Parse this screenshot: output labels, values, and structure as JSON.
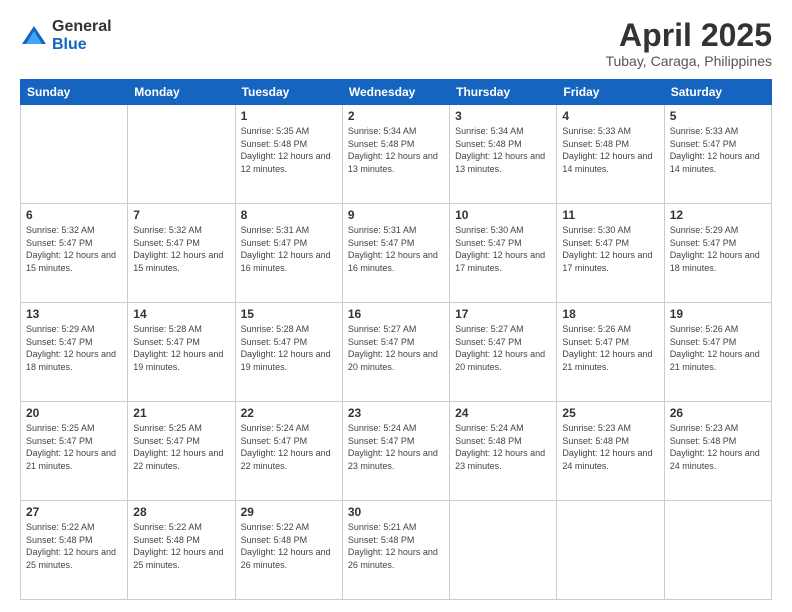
{
  "logo": {
    "general": "General",
    "blue": "Blue"
  },
  "title": "April 2025",
  "subtitle": "Tubay, Caraga, Philippines",
  "weekdays": [
    "Sunday",
    "Monday",
    "Tuesday",
    "Wednesday",
    "Thursday",
    "Friday",
    "Saturday"
  ],
  "weeks": [
    [
      {
        "day": "",
        "sunrise": "",
        "sunset": "",
        "daylight": ""
      },
      {
        "day": "",
        "sunrise": "",
        "sunset": "",
        "daylight": ""
      },
      {
        "day": "1",
        "sunrise": "Sunrise: 5:35 AM",
        "sunset": "Sunset: 5:48 PM",
        "daylight": "Daylight: 12 hours and 12 minutes."
      },
      {
        "day": "2",
        "sunrise": "Sunrise: 5:34 AM",
        "sunset": "Sunset: 5:48 PM",
        "daylight": "Daylight: 12 hours and 13 minutes."
      },
      {
        "day": "3",
        "sunrise": "Sunrise: 5:34 AM",
        "sunset": "Sunset: 5:48 PM",
        "daylight": "Daylight: 12 hours and 13 minutes."
      },
      {
        "day": "4",
        "sunrise": "Sunrise: 5:33 AM",
        "sunset": "Sunset: 5:48 PM",
        "daylight": "Daylight: 12 hours and 14 minutes."
      },
      {
        "day": "5",
        "sunrise": "Sunrise: 5:33 AM",
        "sunset": "Sunset: 5:47 PM",
        "daylight": "Daylight: 12 hours and 14 minutes."
      }
    ],
    [
      {
        "day": "6",
        "sunrise": "Sunrise: 5:32 AM",
        "sunset": "Sunset: 5:47 PM",
        "daylight": "Daylight: 12 hours and 15 minutes."
      },
      {
        "day": "7",
        "sunrise": "Sunrise: 5:32 AM",
        "sunset": "Sunset: 5:47 PM",
        "daylight": "Daylight: 12 hours and 15 minutes."
      },
      {
        "day": "8",
        "sunrise": "Sunrise: 5:31 AM",
        "sunset": "Sunset: 5:47 PM",
        "daylight": "Daylight: 12 hours and 16 minutes."
      },
      {
        "day": "9",
        "sunrise": "Sunrise: 5:31 AM",
        "sunset": "Sunset: 5:47 PM",
        "daylight": "Daylight: 12 hours and 16 minutes."
      },
      {
        "day": "10",
        "sunrise": "Sunrise: 5:30 AM",
        "sunset": "Sunset: 5:47 PM",
        "daylight": "Daylight: 12 hours and 17 minutes."
      },
      {
        "day": "11",
        "sunrise": "Sunrise: 5:30 AM",
        "sunset": "Sunset: 5:47 PM",
        "daylight": "Daylight: 12 hours and 17 minutes."
      },
      {
        "day": "12",
        "sunrise": "Sunrise: 5:29 AM",
        "sunset": "Sunset: 5:47 PM",
        "daylight": "Daylight: 12 hours and 18 minutes."
      }
    ],
    [
      {
        "day": "13",
        "sunrise": "Sunrise: 5:29 AM",
        "sunset": "Sunset: 5:47 PM",
        "daylight": "Daylight: 12 hours and 18 minutes."
      },
      {
        "day": "14",
        "sunrise": "Sunrise: 5:28 AM",
        "sunset": "Sunset: 5:47 PM",
        "daylight": "Daylight: 12 hours and 19 minutes."
      },
      {
        "day": "15",
        "sunrise": "Sunrise: 5:28 AM",
        "sunset": "Sunset: 5:47 PM",
        "daylight": "Daylight: 12 hours and 19 minutes."
      },
      {
        "day": "16",
        "sunrise": "Sunrise: 5:27 AM",
        "sunset": "Sunset: 5:47 PM",
        "daylight": "Daylight: 12 hours and 20 minutes."
      },
      {
        "day": "17",
        "sunrise": "Sunrise: 5:27 AM",
        "sunset": "Sunset: 5:47 PM",
        "daylight": "Daylight: 12 hours and 20 minutes."
      },
      {
        "day": "18",
        "sunrise": "Sunrise: 5:26 AM",
        "sunset": "Sunset: 5:47 PM",
        "daylight": "Daylight: 12 hours and 21 minutes."
      },
      {
        "day": "19",
        "sunrise": "Sunrise: 5:26 AM",
        "sunset": "Sunset: 5:47 PM",
        "daylight": "Daylight: 12 hours and 21 minutes."
      }
    ],
    [
      {
        "day": "20",
        "sunrise": "Sunrise: 5:25 AM",
        "sunset": "Sunset: 5:47 PM",
        "daylight": "Daylight: 12 hours and 21 minutes."
      },
      {
        "day": "21",
        "sunrise": "Sunrise: 5:25 AM",
        "sunset": "Sunset: 5:47 PM",
        "daylight": "Daylight: 12 hours and 22 minutes."
      },
      {
        "day": "22",
        "sunrise": "Sunrise: 5:24 AM",
        "sunset": "Sunset: 5:47 PM",
        "daylight": "Daylight: 12 hours and 22 minutes."
      },
      {
        "day": "23",
        "sunrise": "Sunrise: 5:24 AM",
        "sunset": "Sunset: 5:47 PM",
        "daylight": "Daylight: 12 hours and 23 minutes."
      },
      {
        "day": "24",
        "sunrise": "Sunrise: 5:24 AM",
        "sunset": "Sunset: 5:48 PM",
        "daylight": "Daylight: 12 hours and 23 minutes."
      },
      {
        "day": "25",
        "sunrise": "Sunrise: 5:23 AM",
        "sunset": "Sunset: 5:48 PM",
        "daylight": "Daylight: 12 hours and 24 minutes."
      },
      {
        "day": "26",
        "sunrise": "Sunrise: 5:23 AM",
        "sunset": "Sunset: 5:48 PM",
        "daylight": "Daylight: 12 hours and 24 minutes."
      }
    ],
    [
      {
        "day": "27",
        "sunrise": "Sunrise: 5:22 AM",
        "sunset": "Sunset: 5:48 PM",
        "daylight": "Daylight: 12 hours and 25 minutes."
      },
      {
        "day": "28",
        "sunrise": "Sunrise: 5:22 AM",
        "sunset": "Sunset: 5:48 PM",
        "daylight": "Daylight: 12 hours and 25 minutes."
      },
      {
        "day": "29",
        "sunrise": "Sunrise: 5:22 AM",
        "sunset": "Sunset: 5:48 PM",
        "daylight": "Daylight: 12 hours and 26 minutes."
      },
      {
        "day": "30",
        "sunrise": "Sunrise: 5:21 AM",
        "sunset": "Sunset: 5:48 PM",
        "daylight": "Daylight: 12 hours and 26 minutes."
      },
      {
        "day": "",
        "sunrise": "",
        "sunset": "",
        "daylight": ""
      },
      {
        "day": "",
        "sunrise": "",
        "sunset": "",
        "daylight": ""
      },
      {
        "day": "",
        "sunrise": "",
        "sunset": "",
        "daylight": ""
      }
    ]
  ]
}
